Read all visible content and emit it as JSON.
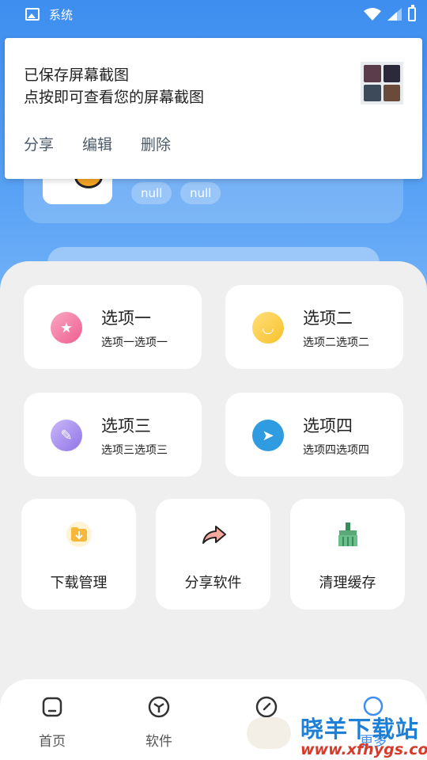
{
  "status_bar": {
    "app_label": "系统"
  },
  "notification": {
    "title": "已保存屏幕截图",
    "text": "点按即可查看您的屏幕截图",
    "actions": [
      "分享",
      "编辑",
      "删除"
    ]
  },
  "profile": {
    "tags": [
      "null",
      "null"
    ]
  },
  "options": [
    {
      "title": "选项一",
      "subtitle": "选项一选项一",
      "icon": "star-icon"
    },
    {
      "title": "选项二",
      "subtitle": "选项二选项二",
      "icon": "chat-smile-icon"
    },
    {
      "title": "选项三",
      "subtitle": "选项三选项三",
      "icon": "note-icon"
    },
    {
      "title": "选项四",
      "subtitle": "选项四选项四",
      "icon": "paper-plane-icon"
    }
  ],
  "tools": [
    {
      "label": "下载管理",
      "icon": "download-folder-icon"
    },
    {
      "label": "分享软件",
      "icon": "share-arrow-icon"
    },
    {
      "label": "清理缓存",
      "icon": "broom-icon"
    }
  ],
  "nav": [
    {
      "label": "首页",
      "icon": "home-icon"
    },
    {
      "label": "软件",
      "icon": "cube-icon"
    },
    {
      "label": "",
      "icon": "compass-icon"
    },
    {
      "label": "更多",
      "icon": "user-icon"
    }
  ],
  "watermark": {
    "title": "晓羊下载站",
    "url": "www.xfhygs.com"
  },
  "colors": {
    "primary": "#3d8ef0",
    "background": "#efefef"
  }
}
